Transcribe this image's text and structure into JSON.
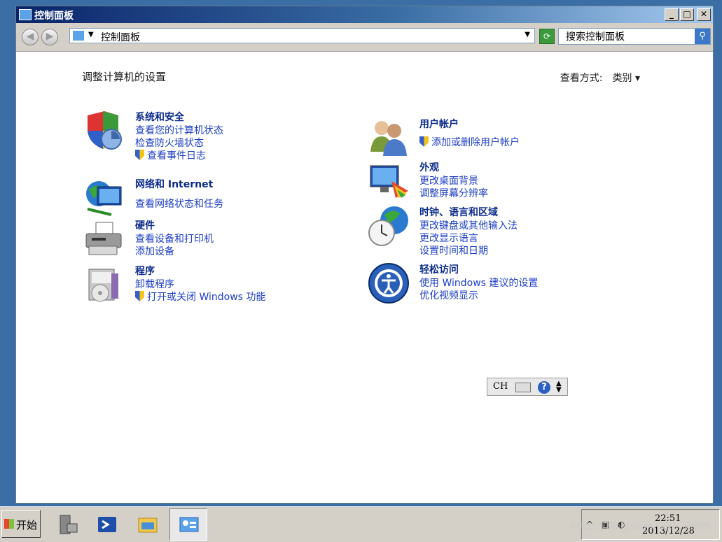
{
  "window": {
    "title": "控制面板",
    "min_symbol": "_",
    "max_symbol": "□",
    "close_symbol": "✕"
  },
  "address": {
    "back_symbol": "◀",
    "forward_symbol": "▶",
    "crumb": "控制面板",
    "refresh_symbol": "⟳",
    "search_value": "搜索控制面板",
    "search_symbol": "⚲"
  },
  "main": {
    "heading": "调整计算机的设置",
    "view_label": "查看方式:",
    "view_value": "类别 ▾"
  },
  "categories": [
    {
      "title": "系统和安全",
      "links": [
        "查看您的计算机状态",
        "检查防火墙状态",
        "查看事件日志"
      ]
    },
    {
      "title": "网络和 Internet",
      "links": [
        "查看网络状态和任务"
      ]
    },
    {
      "title": "硬件",
      "links": [
        "查看设备和打印机",
        "添加设备"
      ]
    },
    {
      "title": "程序",
      "links": [
        "卸载程序",
        "打开或关闭 Windows 功能"
      ]
    },
    {
      "title": "用户帐户",
      "links": [
        "添加或删除用户帐户"
      ]
    },
    {
      "title": "外观",
      "links": [
        "更改桌面背景",
        "调整屏幕分辨率"
      ]
    },
    {
      "title": "时钟、语言和区域",
      "links": [
        "更改键盘或其他输入法",
        "更改显示语言",
        "设置时间和日期"
      ]
    },
    {
      "title": "轻松访问",
      "links": [
        "使用 Windows 建议的设置",
        "优化视频显示"
      ]
    }
  ],
  "langbar": {
    "lang": "CH",
    "help": "?"
  },
  "taskbar": {
    "start_label": "开始",
    "clock_time": "22:51",
    "clock_date": "2013/12/28"
  },
  "watermark": "https://blog.csdn.net/...2999",
  "colors": {
    "link": "#1c3ec4",
    "title": "#0b2a8a",
    "desktop": "#3a6ea5"
  }
}
